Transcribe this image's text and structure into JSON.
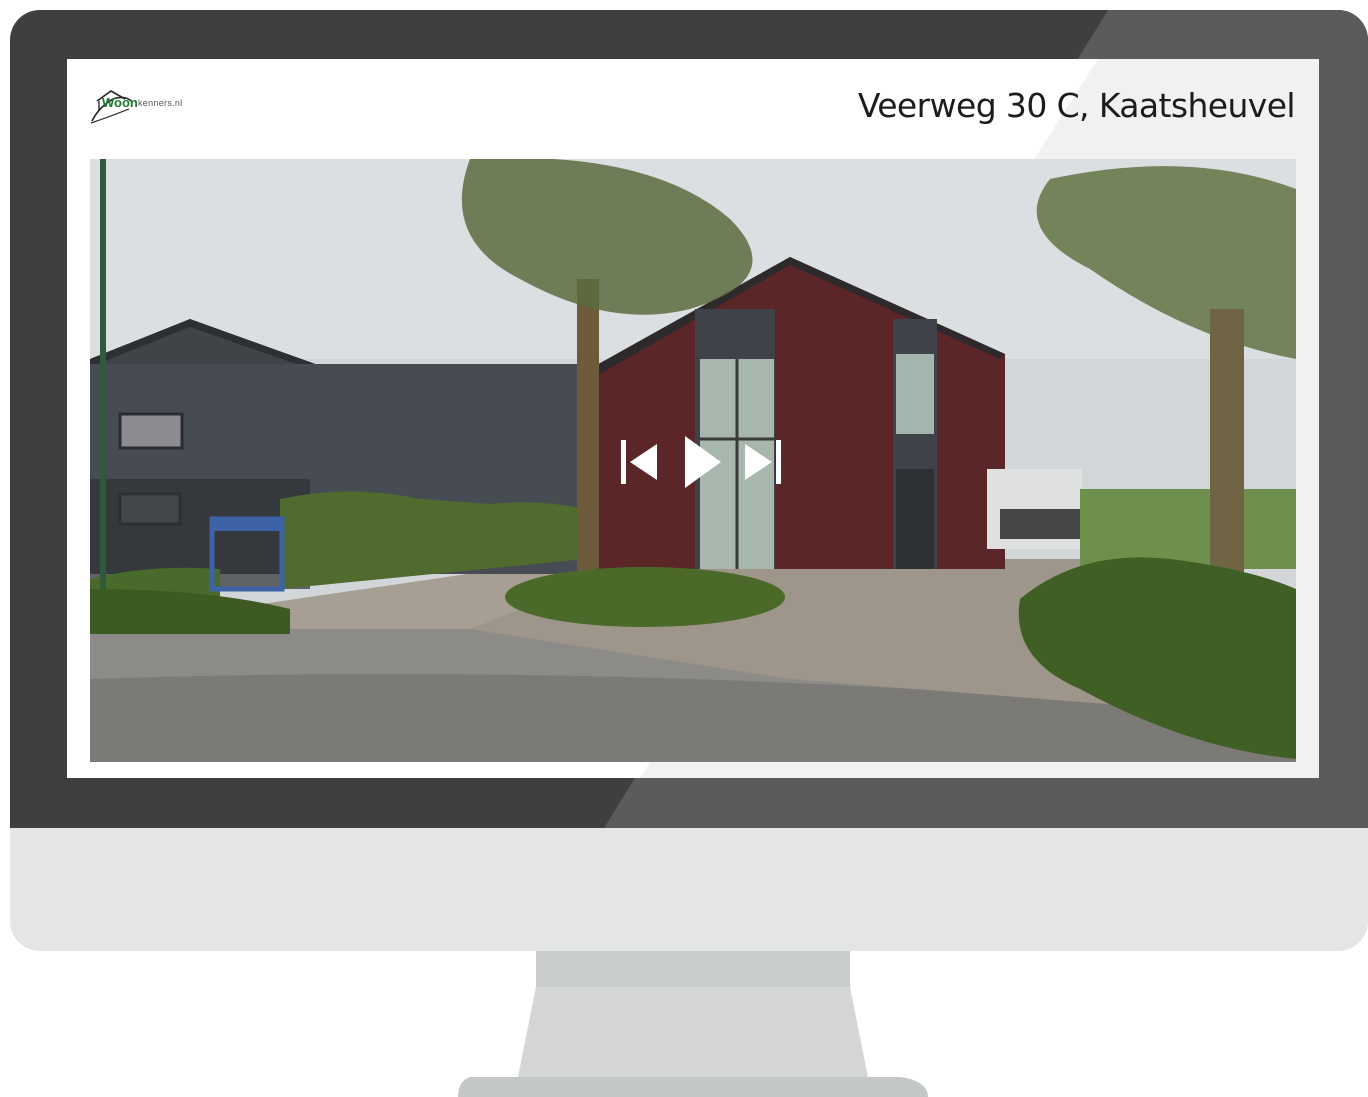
{
  "logo": {
    "brand_bold": "Woon",
    "brand_rest": "kenners.nl"
  },
  "listing": {
    "address": "Veerweg 30 C, Kaatsheuvel"
  },
  "slideshow": {
    "controls": [
      {
        "name": "previous",
        "icon": "skip-previous-icon"
      },
      {
        "name": "play",
        "icon": "play-icon"
      },
      {
        "name": "next",
        "icon": "skip-next-icon"
      }
    ]
  },
  "colors": {
    "bezel": "#3f3f3d",
    "chin": "#e4e5e7",
    "stand": "#d4d6d6",
    "brand_green": "#1a7a2b"
  }
}
